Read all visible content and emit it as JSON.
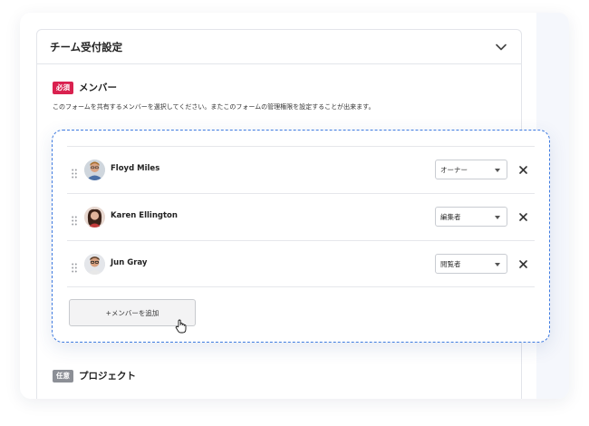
{
  "panel": {
    "title": "チーム受付設定"
  },
  "members_section": {
    "badge": "必須",
    "title": "メンバー",
    "description": "このフォームを共有するメンバーを選択してください。またこのフォームの管理権限を設定することが出来ます。"
  },
  "members": [
    {
      "name": "Floyd Miles",
      "role": "オーナー"
    },
    {
      "name": "Karen Ellington",
      "role": "編集者"
    },
    {
      "name": "Jun Gray",
      "role": "閲覧者"
    }
  ],
  "add_member_label": "+メンバーを追加",
  "project_section": {
    "badge": "任意",
    "title": "プロジェクト"
  },
  "colors": {
    "required_badge": "#d9214f",
    "optional_badge": "#8c8f96",
    "dashed_border": "#3f7be0"
  },
  "icons": [
    "chevron-down-icon",
    "drag-handle-icon",
    "close-icon",
    "hand-cursor-icon"
  ]
}
